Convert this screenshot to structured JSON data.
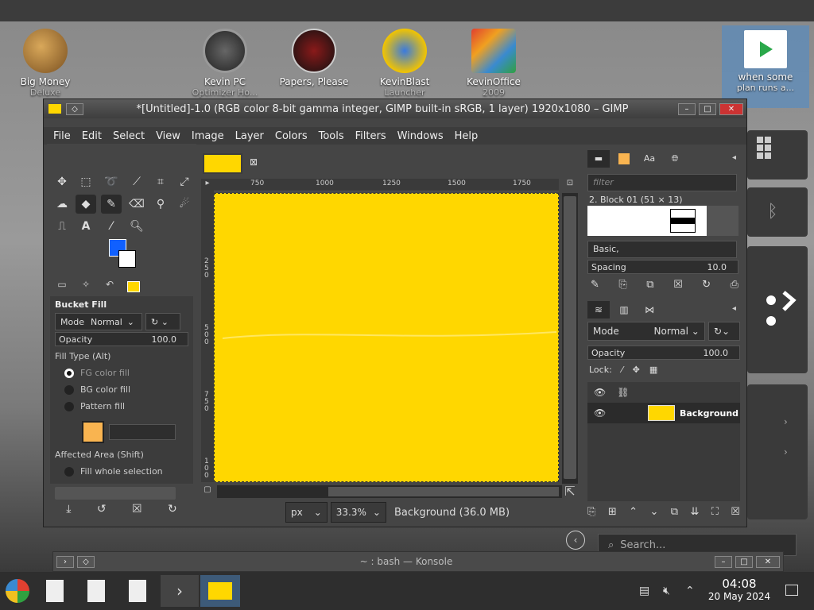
{
  "desktop": {
    "icons": [
      {
        "label": "Big Money",
        "label2": "Deluxe"
      },
      {
        "label": "Kevin PC",
        "label2": "Optimizer Ho..."
      },
      {
        "label": "Papers, Please",
        "label2": ""
      },
      {
        "label": "KevinBlast",
        "label2": "Launcher"
      },
      {
        "label": "KevinOffice",
        "label2": "2009"
      },
      {
        "label": "when some",
        "label2": "plan runs a..."
      }
    ]
  },
  "gimp": {
    "title": "*[Untitled]-1.0 (RGB color 8-bit gamma integer, GIMP built-in sRGB, 1 layer) 1920x1080 – GIMP",
    "menu": [
      "File",
      "Edit",
      "Select",
      "View",
      "Image",
      "Layer",
      "Colors",
      "Tools",
      "Filters",
      "Windows",
      "Help"
    ],
    "colors": {
      "foreground": "#1060ff",
      "background": "#ffffff",
      "canvas": "#ffd700"
    },
    "tool_options": {
      "title": "Bucket Fill",
      "mode_label": "Mode",
      "mode_value": "Normal",
      "opacity_label": "Opacity",
      "opacity_value": "100.0",
      "fill_type_label": "Fill Type  (Alt)",
      "fill_options": [
        "FG color fill",
        "BG color fill",
        "Pattern fill"
      ],
      "affected_area_label": "Affected Area  (Shift)",
      "affected_option": "Fill whole selection"
    },
    "ruler": {
      "h_ticks": [
        "750",
        "1000",
        "1250",
        "1500",
        "1750"
      ],
      "v_ticks": [
        "2\n5\n0",
        "5\n0\n0",
        "7\n5\n0",
        "1\n0\n0"
      ]
    },
    "status": {
      "unit": "px",
      "zoom": "33.3%",
      "info": "Background (36.0 MB)"
    },
    "brushes": {
      "filter_placeholder": "filter",
      "brush_name": "2. Block 01 (51 × 13)",
      "preset": "Basic,",
      "spacing_label": "Spacing",
      "spacing_value": "10.0"
    },
    "layers": {
      "mode_label": "Mode",
      "mode_value": "Normal",
      "opacity_label": "Opacity",
      "opacity_value": "100.0",
      "lock_label": "Lock:",
      "items": [
        {
          "name": "Background"
        }
      ]
    }
  },
  "search": {
    "placeholder": "Search..."
  },
  "konsole": {
    "title": "~ : bash — Konsole"
  },
  "clock": {
    "time": "04:08",
    "date": "20 May 2024"
  }
}
